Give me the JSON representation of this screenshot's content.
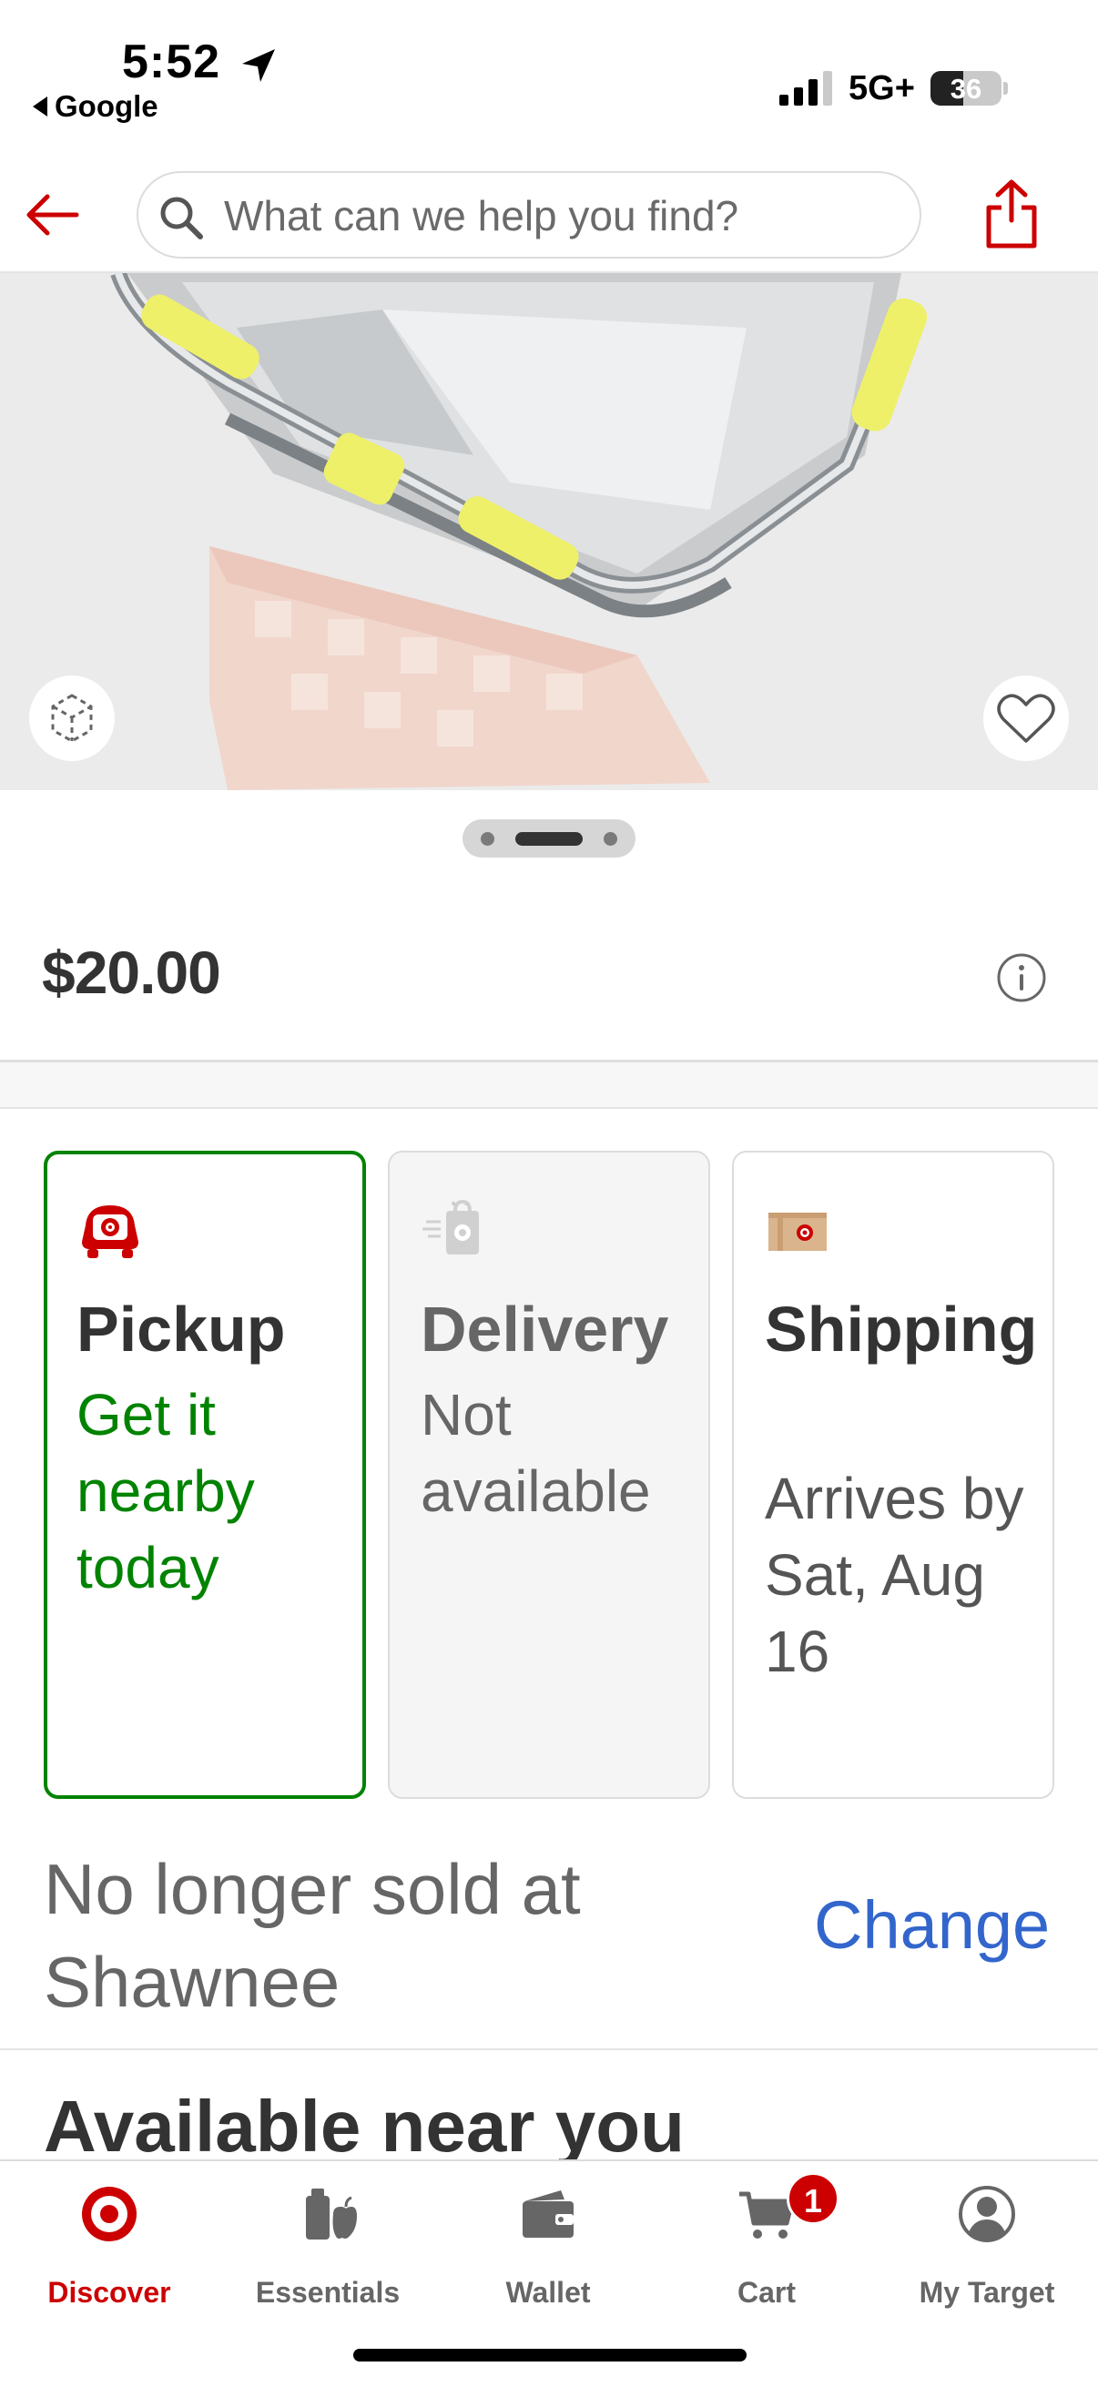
{
  "status_bar": {
    "time": "5:52",
    "back_app": "Google",
    "network": "5G+",
    "battery": "36"
  },
  "header": {
    "search_placeholder": "What can we help you find?",
    "icons": [
      "back-arrow-icon",
      "search-icon",
      "share-icon"
    ]
  },
  "product": {
    "price": "$20.00",
    "image_page": {
      "current": 2,
      "total": 3
    }
  },
  "fulfillment": {
    "pickup": {
      "title": "Pickup",
      "status": "Get it nearby today"
    },
    "delivery": {
      "title": "Delivery",
      "status": "Not available"
    },
    "shipping": {
      "title": "Shipping",
      "status": "Arrives by Sat, Aug 16"
    }
  },
  "store": {
    "text": "No longer sold at Shawnee",
    "change_label": "Change"
  },
  "section_title": "Available near you",
  "bottom_nav": {
    "items": [
      {
        "label": "Discover",
        "icon": "target-logo-icon",
        "active": true
      },
      {
        "label": "Essentials",
        "icon": "essentials-icon",
        "active": false
      },
      {
        "label": "Wallet",
        "icon": "wallet-icon",
        "active": false
      },
      {
        "label": "Cart",
        "icon": "cart-icon",
        "active": false
      },
      {
        "label": "My Target",
        "icon": "account-icon",
        "active": false
      }
    ],
    "cart_count": "1"
  },
  "colors": {
    "brand_red": "#cc0000",
    "pickup_green": "#008300",
    "link_blue": "#3366cc"
  }
}
